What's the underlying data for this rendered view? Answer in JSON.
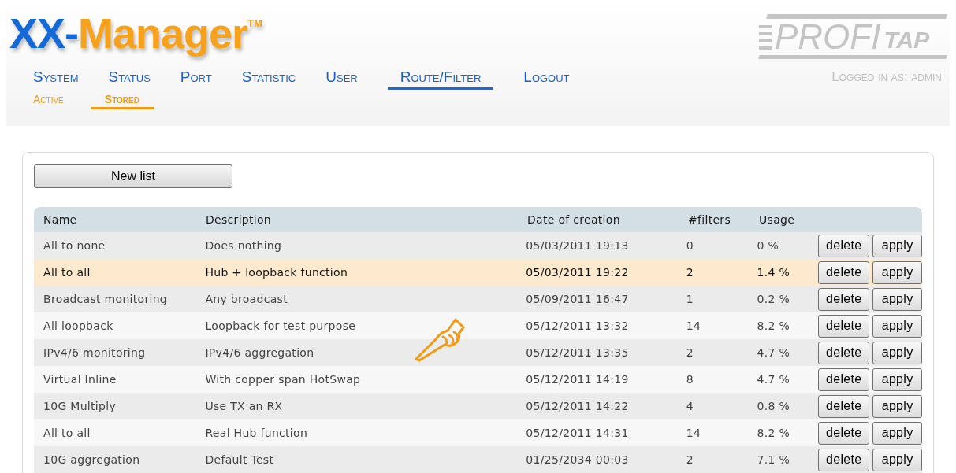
{
  "logo": {
    "prefix": "XX-",
    "name": "Manager",
    "mark": "TM"
  },
  "brand": {
    "left": "PROFI",
    "right": "TAP"
  },
  "nav": [
    {
      "label": "System",
      "selected": false
    },
    {
      "label": "Status",
      "selected": false
    },
    {
      "label": "Port",
      "selected": false
    },
    {
      "label": "Statistic",
      "selected": false
    },
    {
      "label": "User",
      "selected": false
    },
    {
      "label": "Route/Filter",
      "selected": true
    },
    {
      "label": "Logout",
      "selected": false
    }
  ],
  "login_status": "Logged in as: admin",
  "subnav": [
    {
      "label": "Active",
      "selected": false
    },
    {
      "label": "Stored",
      "selected": true
    }
  ],
  "new_list_button": "New list",
  "table": {
    "columns": [
      "Name",
      "Description",
      "Date of creation",
      "#filters",
      "Usage"
    ],
    "rows": [
      {
        "name": "All to none",
        "description": "Does nothing",
        "date": "05/03/2011 19:13",
        "filters": "0",
        "usage": "0 %",
        "selected": false,
        "delete": "delete",
        "apply": "apply"
      },
      {
        "name": "All to all",
        "description": "Hub + loopback function",
        "date": "05/03/2011 19:22",
        "filters": "2",
        "usage": "1.4 %",
        "selected": true,
        "delete": "delete",
        "apply": "apply"
      },
      {
        "name": "Broadcast monitoring",
        "description": "Any broadcast",
        "date": "05/09/2011 16:47",
        "filters": "1",
        "usage": "0.2 %",
        "selected": false,
        "delete": "delete",
        "apply": "apply"
      },
      {
        "name": "All loopback",
        "description": "Loopback for test purpose",
        "date": "05/12/2011 13:32",
        "filters": "14",
        "usage": "8.2 %",
        "selected": false,
        "delete": "delete",
        "apply": "apply"
      },
      {
        "name": "IPv4/6 monitoring",
        "description": "IPv4/6 aggregation",
        "date": "05/12/2011 13:35",
        "filters": "2",
        "usage": "4.7 %",
        "selected": false,
        "delete": "delete",
        "apply": "apply"
      },
      {
        "name": "Virtual Inline",
        "description": "With copper span HotSwap",
        "date": "05/12/2011 14:19",
        "filters": "8",
        "usage": "4.7 %",
        "selected": false,
        "delete": "delete",
        "apply": "apply"
      },
      {
        "name": "10G Multiply",
        "description": "Use TX an RX",
        "date": "05/12/2011 14:22",
        "filters": "4",
        "usage": "0.8 %",
        "selected": false,
        "delete": "delete",
        "apply": "apply"
      },
      {
        "name": "All to all",
        "description": "Real Hub function",
        "date": "05/12/2011 14:31",
        "filters": "14",
        "usage": "8.2 %",
        "selected": false,
        "delete": "delete",
        "apply": "apply"
      },
      {
        "name": "10G aggregation",
        "description": "Default Test",
        "date": "01/25/2034 00:03",
        "filters": "2",
        "usage": "7.1 %",
        "selected": false,
        "delete": "delete",
        "apply": "apply"
      }
    ]
  }
}
